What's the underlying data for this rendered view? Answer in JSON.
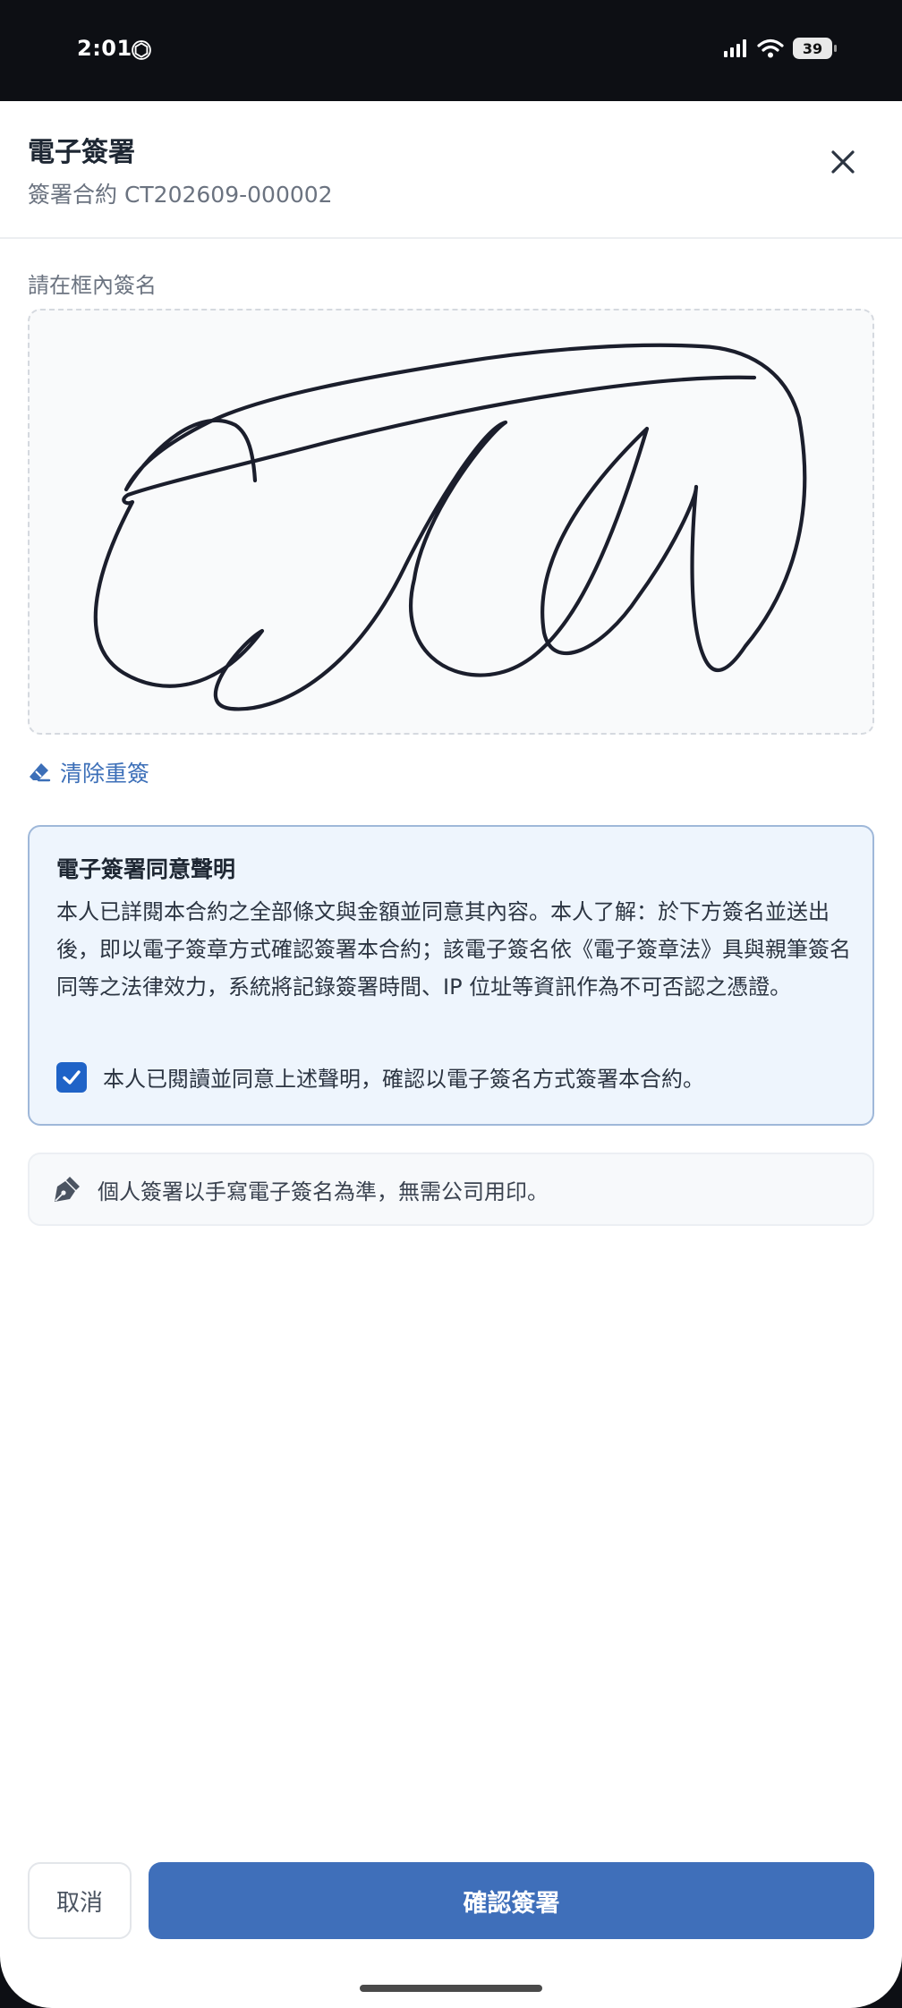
{
  "status_bar": {
    "time": "2:01",
    "battery": "39"
  },
  "header": {
    "title": "電子簽署",
    "subtitle": "簽署合約 CT202609-000002",
    "close_icon": "close-icon"
  },
  "signature_pad": {
    "label": "請在框內簽名",
    "clear_label": "清除重簽"
  },
  "consent": {
    "title": "電子簽署同意聲明",
    "body": "本人已詳閱本合約之全部條文與金額並同意其內容。本人了解：於下方簽名並送出後，即以電子簽章方式確認簽署本合約；該電子簽名依《電子簽章法》具與親筆簽名同等之法律效力，系統將記錄簽署時間、IP 位址等資訊作為不可否認之憑證。",
    "checkbox_label": "本人已閱讀並同意上述聲明，確認以電子簽名方式簽署本合約。",
    "checked": true
  },
  "note": {
    "icon": "pen-icon",
    "text": "個人簽署以手寫電子簽名為準，無需公司用印。"
  },
  "actions": {
    "cancel_label": "取消",
    "confirm_label": "確認簽署"
  },
  "colors": {
    "primary": "#3f6fba",
    "checkbox": "#1f63c7",
    "link": "#3c6fb8",
    "consent_bg": "#eef5fd"
  }
}
